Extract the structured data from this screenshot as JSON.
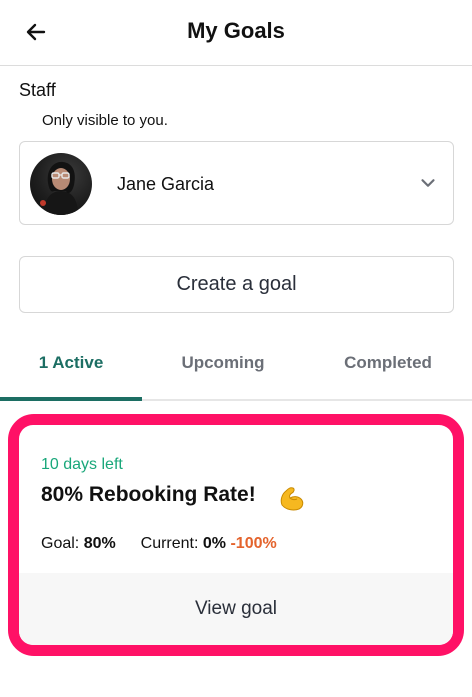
{
  "header": {
    "title": "My Goals",
    "back_icon": "arrow-left-icon"
  },
  "staff": {
    "label": "Staff",
    "note": "Only visible to you.",
    "selected_name": "Jane Garcia",
    "dropdown_icon": "chevron-down-icon"
  },
  "actions": {
    "create_goal_label": "Create a goal"
  },
  "tabs": [
    {
      "label": "1 Active",
      "active": true
    },
    {
      "label": "Upcoming",
      "active": false
    },
    {
      "label": "Completed",
      "active": false
    }
  ],
  "goal_card": {
    "days_left": "10 days left",
    "title": "80% Rebooking Rate!",
    "emoji_icon": "flexed-biceps-icon",
    "goal_label": "Goal:",
    "goal_value": "80%",
    "current_label": "Current:",
    "current_value": "0%",
    "change_value": "-100%",
    "view_label": "View goal"
  },
  "colors": {
    "accent_green": "#1c6e63",
    "days_left_green": "#19a77a",
    "highlight_pink": "#ff1166",
    "change_orange": "#e4632c"
  }
}
